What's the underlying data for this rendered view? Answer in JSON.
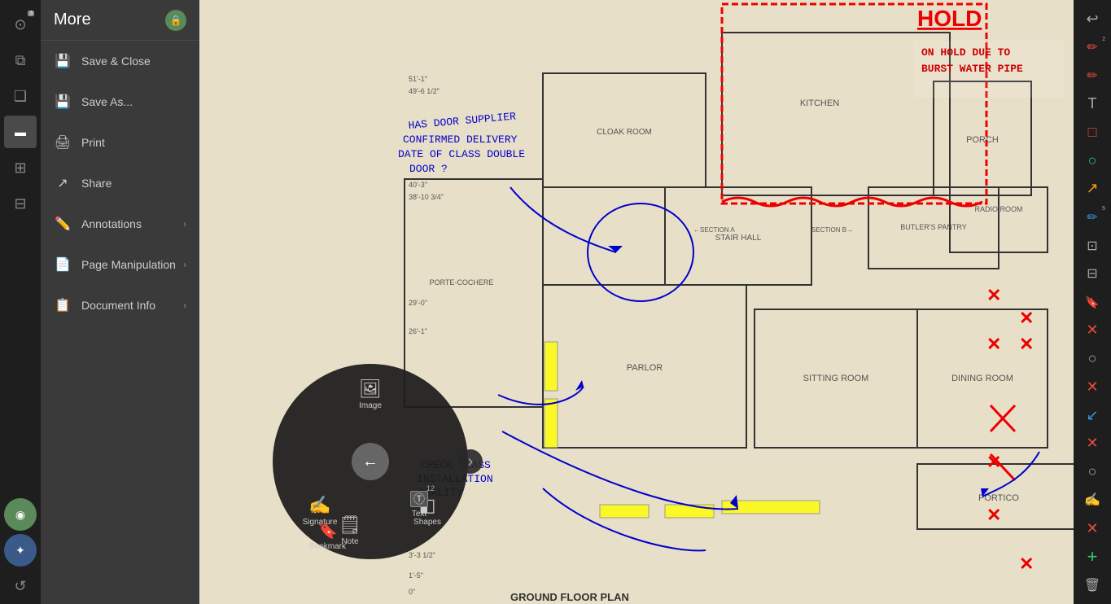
{
  "app": {
    "title": "More"
  },
  "sidebar": {
    "title": "More",
    "lock_icon": "🔒",
    "menu_items": [
      {
        "id": "save-close",
        "label": "Save & Close",
        "icon": "💾",
        "has_arrow": false
      },
      {
        "id": "save-as",
        "label": "Save As...",
        "icon": "💾",
        "has_arrow": false
      },
      {
        "id": "print",
        "label": "Print",
        "icon": "🖨",
        "has_arrow": false
      },
      {
        "id": "share",
        "label": "Share",
        "icon": "↗",
        "has_arrow": false
      },
      {
        "id": "annotations",
        "label": "Annotations",
        "icon": "✏️",
        "has_arrow": true
      },
      {
        "id": "page-manipulation",
        "label": "Page Manipulation",
        "icon": "📄",
        "has_arrow": true
      },
      {
        "id": "document-info",
        "label": "Document Info",
        "icon": "📋",
        "has_arrow": true
      }
    ]
  },
  "left_strip": {
    "icons": [
      {
        "id": "home",
        "symbol": "⊙",
        "badge": "3",
        "active": false
      },
      {
        "id": "layers",
        "symbol": "⧉",
        "badge": "",
        "active": false
      },
      {
        "id": "copy",
        "symbol": "❑",
        "badge": "",
        "active": false
      },
      {
        "id": "active-tool",
        "symbol": "▬",
        "badge": "",
        "active": true
      },
      {
        "id": "map",
        "symbol": "⊞",
        "badge": "",
        "active": false
      },
      {
        "id": "bookmark2",
        "symbol": "⊟",
        "badge": "",
        "active": false
      },
      {
        "id": "user1",
        "symbol": "◉",
        "badge": "",
        "active": false
      },
      {
        "id": "user2",
        "symbol": "✦",
        "badge": "",
        "active": false
      },
      {
        "id": "refresh",
        "symbol": "↺",
        "badge": "",
        "active": false
      }
    ]
  },
  "right_toolbar": {
    "icons": [
      {
        "id": "undo",
        "symbol": "↩",
        "color": "normal",
        "badge": ""
      },
      {
        "id": "pen-red",
        "symbol": "✏",
        "color": "red",
        "badge": "2"
      },
      {
        "id": "pen-red2",
        "symbol": "✏",
        "color": "red",
        "badge": ""
      },
      {
        "id": "text-tool",
        "symbol": "T",
        "color": "normal",
        "badge": ""
      },
      {
        "id": "rect-red",
        "symbol": "□",
        "color": "red",
        "badge": ""
      },
      {
        "id": "circle",
        "symbol": "○",
        "color": "green",
        "badge": ""
      },
      {
        "id": "arrow-yellow",
        "symbol": "↗",
        "color": "yellow",
        "badge": ""
      },
      {
        "id": "pen-blue",
        "symbol": "✏",
        "color": "blue",
        "badge": "5"
      },
      {
        "id": "camera",
        "symbol": "⊡",
        "color": "normal",
        "badge": ""
      },
      {
        "id": "tag",
        "symbol": "⊟",
        "color": "normal",
        "badge": ""
      },
      {
        "id": "bookmark",
        "symbol": "🔖",
        "color": "normal",
        "badge": ""
      },
      {
        "id": "x-red1",
        "symbol": "✕",
        "color": "red",
        "badge": ""
      },
      {
        "id": "circle2",
        "symbol": "○",
        "color": "normal",
        "badge": ""
      },
      {
        "id": "x-red2",
        "symbol": "✕",
        "color": "red",
        "badge": ""
      },
      {
        "id": "arrow-blue",
        "symbol": "↙",
        "color": "blue",
        "badge": ""
      },
      {
        "id": "x-red3",
        "symbol": "✕",
        "color": "red",
        "badge": ""
      },
      {
        "id": "circle3",
        "symbol": "○",
        "color": "normal",
        "badge": ""
      },
      {
        "id": "pen-tool",
        "symbol": "✍",
        "color": "normal",
        "badge": ""
      },
      {
        "id": "x-red4",
        "symbol": "✕",
        "color": "red",
        "badge": ""
      },
      {
        "id": "plus-green",
        "symbol": "+",
        "color": "green",
        "badge": ""
      },
      {
        "id": "trash",
        "symbol": "🗑",
        "color": "normal",
        "badge": ""
      }
    ]
  },
  "radial_menu": {
    "items": [
      {
        "id": "image",
        "label": "Image",
        "icon": "🖼",
        "position": "top"
      },
      {
        "id": "signature",
        "label": "Signature",
        "icon": "✍",
        "position": "bottom-left1"
      },
      {
        "id": "shapes",
        "label": "Shapes",
        "icon": "◧",
        "position": "bottom-right"
      },
      {
        "id": "note",
        "label": "Note",
        "icon": "🗒",
        "position": "bottom-left2"
      },
      {
        "id": "bookmark-item",
        "label": "Bookmark",
        "icon": "🔖",
        "position": "bottom-center-left"
      },
      {
        "id": "text",
        "label": "Text",
        "icon": "Ⓣ",
        "position": "bottom-center-right"
      }
    ],
    "center_icon": "←",
    "arrow_icon": "›"
  },
  "blueprint": {
    "annotations": [
      {
        "id": "blue-text-1",
        "text": "HAS DOOR SUPPLIER CONFIRMED DELIVERY DATE OF CLASS DOUBLE DOOR ?",
        "color": "blue"
      },
      {
        "id": "red-hold",
        "text": "HOLD",
        "color": "red"
      },
      {
        "id": "red-note",
        "text": "ON HOLD DUE TO BURST WATER PIPE",
        "color": "red"
      },
      {
        "id": "blue-text-2",
        "text": "CHECK CLASS INSTALLATION QUALITY",
        "color": "blue"
      }
    ],
    "rooms": [
      "KITCHEN",
      "CLOAK ROOM",
      "STAIR HALL",
      "PORCH",
      "RADIO ROOM",
      "BUTLER'S PANTRY",
      "PORTE-COCHERE",
      "SITTING ROOM",
      "DINING ROOM",
      "PARLOR",
      "PORTICO",
      "GROUND FLOOR PLAN"
    ]
  }
}
